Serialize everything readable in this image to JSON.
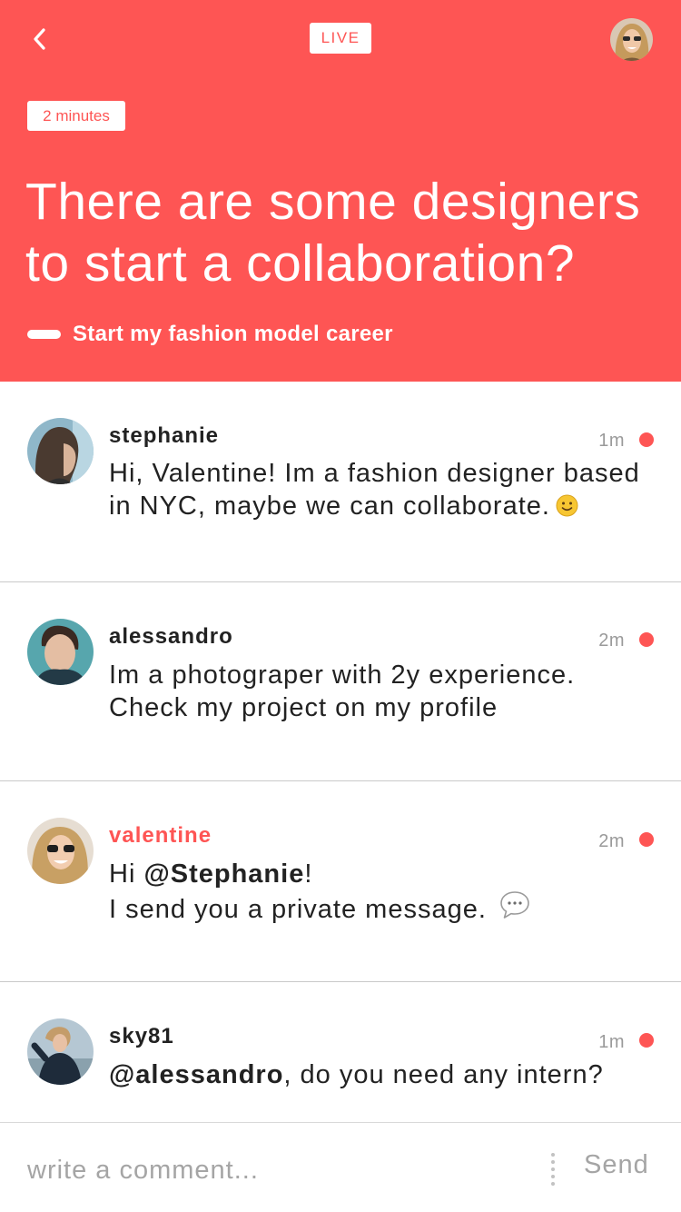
{
  "colors": {
    "accent": "#fe5554",
    "text": "#222222",
    "muted": "#9a9a9a",
    "divider": "#c9c9c9"
  },
  "header": {
    "back_icon": "chevron-left-icon",
    "live_label": "LIVE",
    "time_badge": "2 minutes",
    "question": "There are some designers to start a collaboration?",
    "tag_label": "Start my fashion model career"
  },
  "comments": [
    {
      "user": "stephanie",
      "time": "1m",
      "text": "Hi, Valentine! Im a fashion designer based in NYC, maybe we can collaborate.",
      "emoji": "smile-emoji-icon"
    },
    {
      "user": "alessandro",
      "time": "2m",
      "text": "Im a photograper with 2y experience. Check my project on my profile"
    },
    {
      "user": "valentine",
      "time": "2m",
      "mention": "@Stephanie",
      "text_before": "Hi ",
      "text_after": "!",
      "text_line2": "I send you a private message.",
      "icon": "chat-bubble-icon"
    },
    {
      "user": "sky81",
      "time": "1m",
      "mention": "@alessandro",
      "text_after": ", do you need any intern?"
    }
  ],
  "input": {
    "placeholder": "write a comment...",
    "value": "",
    "send_label": "Send"
  }
}
